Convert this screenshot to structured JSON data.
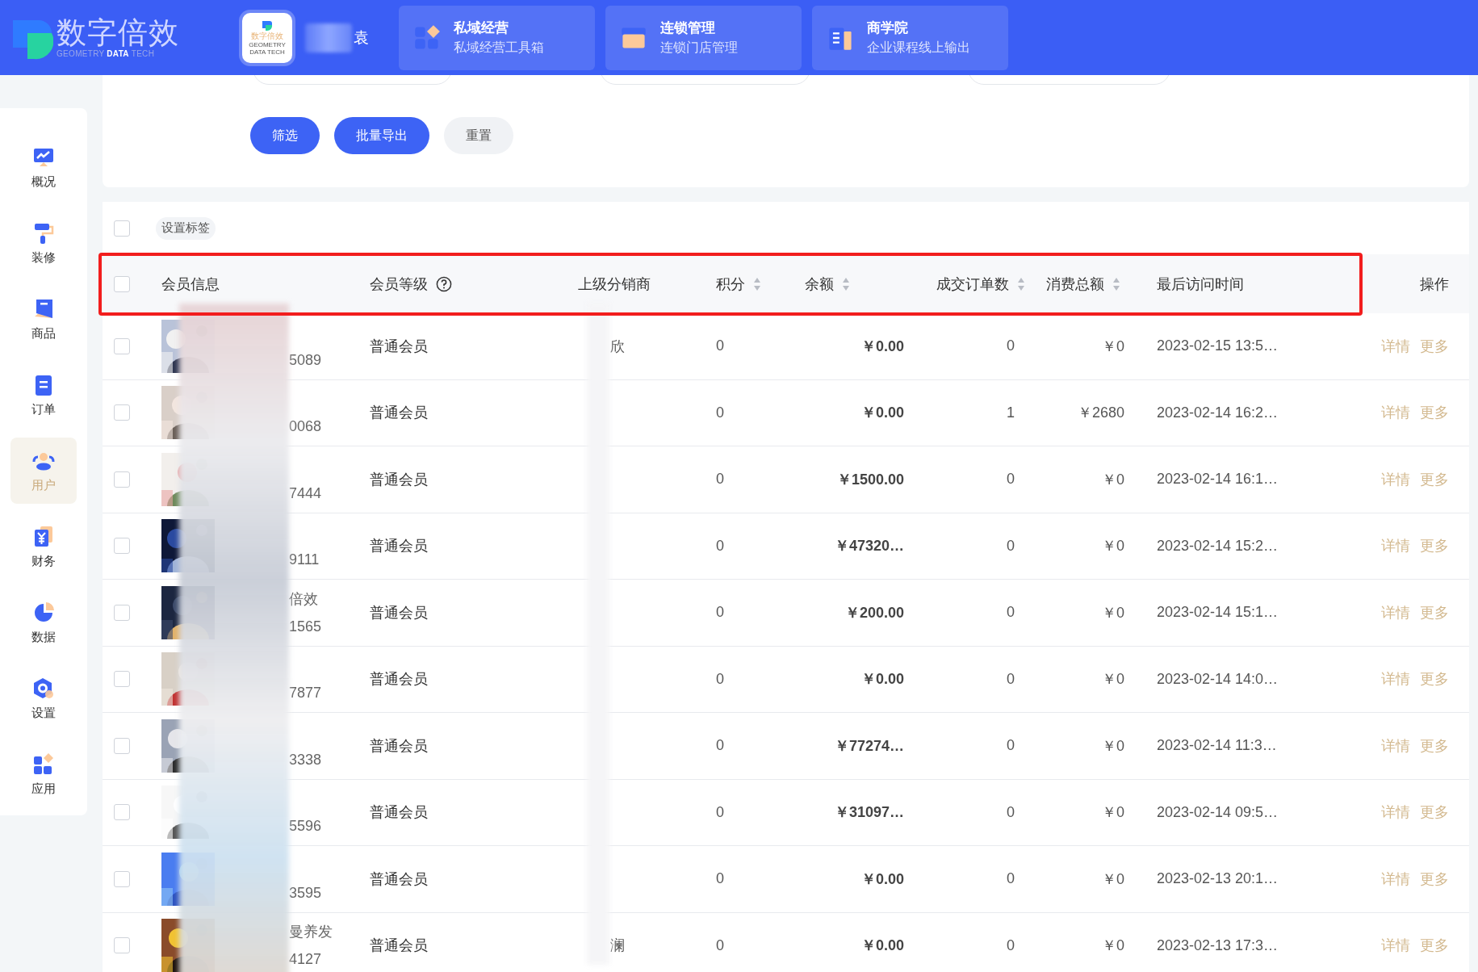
{
  "header": {
    "logo": {
      "name": "数字倍效",
      "tagline": "GEOMETRY **DATA** TECH"
    },
    "store": {
      "logo_name": "数字倍效",
      "logo_tagline": "GEOMETRY DATA TECH",
      "name": "袁"
    },
    "nav": [
      {
        "title": "私域经营",
        "subtitle": "私域经营工具箱"
      },
      {
        "title": "连锁管理",
        "subtitle": "连锁门店管理"
      },
      {
        "title": "商学院",
        "subtitle": "企业课程线上输出"
      }
    ]
  },
  "sidebar": {
    "items": [
      {
        "label": "概况",
        "selected": false
      },
      {
        "label": "装修",
        "selected": false
      },
      {
        "label": "商品",
        "selected": false
      },
      {
        "label": "订单",
        "selected": false
      },
      {
        "label": "用户",
        "selected": true
      },
      {
        "label": "财务",
        "selected": false
      },
      {
        "label": "数据",
        "selected": false
      },
      {
        "label": "设置",
        "selected": false
      },
      {
        "label": "应用",
        "selected": false
      }
    ]
  },
  "filters": {
    "buttons": [
      {
        "label": "筛选",
        "kind": "primary"
      },
      {
        "label": "批量导出",
        "kind": "primary"
      },
      {
        "label": "重置",
        "kind": "plain"
      }
    ]
  },
  "table": {
    "toolbar": {
      "checked": false,
      "tag_button": "设置标签"
    },
    "header_checked": false,
    "columns": [
      {
        "label": "会员信息"
      },
      {
        "label": "会员等级",
        "help": true
      },
      {
        "label": "上级分销商"
      },
      {
        "label": "积分",
        "sortable": true
      },
      {
        "label": "余额",
        "sortable": true
      },
      {
        "label": "成交订单数",
        "sortable": true
      },
      {
        "label": "消费总额",
        "sortable": true
      },
      {
        "label": "最后访问时间"
      },
      {
        "label": "操作"
      }
    ],
    "rows": [
      {
        "checked": false,
        "phone": "5089",
        "level": "普通会员",
        "distributor": "欣",
        "points": "0",
        "balance": "￥0.00",
        "orders": "0",
        "spent": "￥0",
        "last_visit": "2023-02-15 13:5…",
        "actions": [
          "详情",
          "更多"
        ]
      },
      {
        "checked": false,
        "phone": "0068",
        "level": "普通会员",
        "points": "0",
        "balance": "￥0.00",
        "orders": "1",
        "spent": "￥2680",
        "last_visit": "2023-02-14 16:2…",
        "actions": [
          "详情",
          "更多"
        ]
      },
      {
        "checked": false,
        "phone": "7444",
        "level": "普通会员",
        "points": "0",
        "balance": "￥1500.00",
        "orders": "0",
        "spent": "￥0",
        "last_visit": "2023-02-14 16:1…",
        "actions": [
          "详情",
          "更多"
        ]
      },
      {
        "checked": false,
        "phone": "9111",
        "level": "普通会员",
        "points": "0",
        "balance": "￥47320…",
        "orders": "0",
        "spent": "￥0",
        "last_visit": "2023-02-14 15:2…",
        "actions": [
          "详情",
          "更多"
        ]
      },
      {
        "checked": false,
        "name": "倍效",
        "phone": "1565",
        "level": "普通会员",
        "points": "0",
        "balance": "￥200.00",
        "orders": "0",
        "spent": "￥0",
        "last_visit": "2023-02-14 15:1…",
        "actions": [
          "详情",
          "更多"
        ]
      },
      {
        "checked": false,
        "phone": "7877",
        "level": "普通会员",
        "points": "0",
        "balance": "￥0.00",
        "orders": "0",
        "spent": "￥0",
        "last_visit": "2023-02-14 14:0…",
        "actions": [
          "详情",
          "更多"
        ]
      },
      {
        "checked": false,
        "phone": "3338",
        "level": "普通会员",
        "points": "0",
        "balance": "￥77274…",
        "orders": "0",
        "spent": "￥0",
        "last_visit": "2023-02-14 11:3…",
        "actions": [
          "详情",
          "更多"
        ]
      },
      {
        "checked": false,
        "phone": "5596",
        "level": "普通会员",
        "points": "0",
        "balance": "￥31097…",
        "orders": "0",
        "spent": "￥0",
        "last_visit": "2023-02-14 09:5…",
        "actions": [
          "详情",
          "更多"
        ]
      },
      {
        "checked": false,
        "phone": "3595",
        "level": "普通会员",
        "points": "0",
        "balance": "￥0.00",
        "orders": "0",
        "spent": "￥0",
        "last_visit": "2023-02-13 20:1…",
        "actions": [
          "详情",
          "更多"
        ]
      },
      {
        "checked": false,
        "name": "曼养发",
        "phone": "4127",
        "level": "普通会员",
        "distributor": "澜",
        "points": "0",
        "balance": "￥0.00",
        "orders": "0",
        "spent": "￥0",
        "last_visit": "2023-02-13 17:3…",
        "actions": [
          "详情",
          "更多"
        ]
      }
    ]
  }
}
